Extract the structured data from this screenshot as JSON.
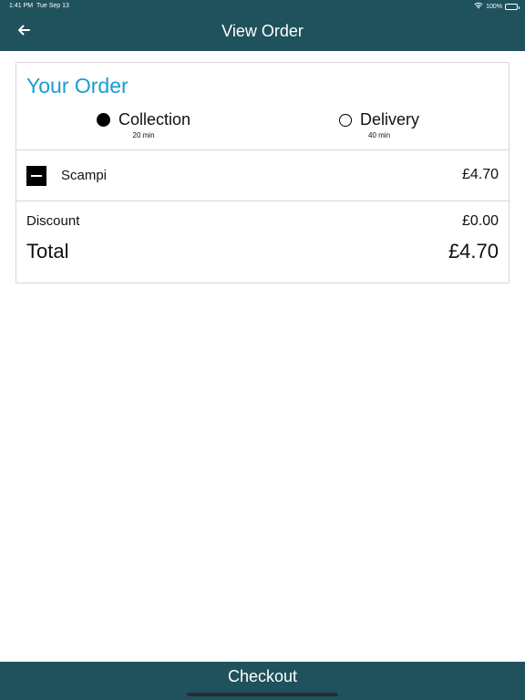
{
  "status_bar": {
    "time": "1:41 PM",
    "date": "Tue Sep 13",
    "battery": "100%"
  },
  "nav": {
    "title": "View Order",
    "back_icon": "arrow-left-icon"
  },
  "order": {
    "heading": "Your Order",
    "options": [
      {
        "label": "Collection",
        "time": "20 min",
        "selected": true
      },
      {
        "label": "Delivery",
        "time": "40 min",
        "selected": false
      }
    ],
    "items": [
      {
        "name": "Scampi",
        "price": "£4.70"
      }
    ],
    "discount_label": "Discount",
    "discount_value": "£0.00",
    "total_label": "Total",
    "total_value": "£4.70"
  },
  "checkout": {
    "label": "Checkout"
  },
  "colors": {
    "header": "#1f525c",
    "accent": "#1a9bd4"
  }
}
